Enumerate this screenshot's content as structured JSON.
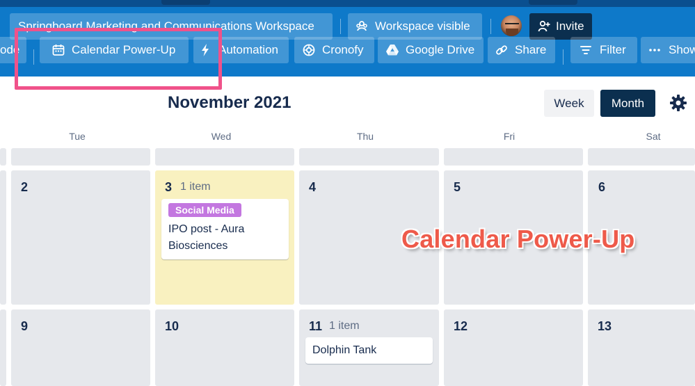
{
  "board": {
    "workspace_name": "Springboard Marketing and Communications Workspace",
    "visibility_label": "Workspace visible",
    "invite_label": "Invite"
  },
  "toolbar": {
    "cut_label": "ode",
    "calendar_label": "Calendar Power-Up",
    "automation_label": "Automation",
    "cronofy_label": "Cronofy",
    "google_drive_label": "Google Drive",
    "share_label": "Share",
    "filter_label": "Filter",
    "show_menu_label": "Show"
  },
  "calendar": {
    "month_title": "November 2021",
    "view_week_label": "Week",
    "view_month_label": "Month",
    "weekdays": [
      "Tue",
      "Wed",
      "Thu",
      "Fri",
      "Sat"
    ],
    "week1": {
      "days": [
        "2",
        "3",
        "4",
        "5",
        "6"
      ],
      "today_item_count": "1 item",
      "card": {
        "label": "Social Media",
        "title_line1": "IPO post - Aura",
        "title_line2": "Biosciences"
      }
    },
    "week2": {
      "days": [
        "9",
        "10",
        "11",
        "12",
        "13"
      ],
      "item_count": "1 item",
      "card": {
        "title": "Dolphin Tank"
      }
    }
  },
  "annotation": {
    "text": "Calendar Power-Up"
  },
  "colors": {
    "header_blue": "#0e79c9",
    "highlight_pink": "#f0528a",
    "label_purple": "#c377e0",
    "today_yellow": "#f9f1c0",
    "annotation_red": "#ee5a4a"
  }
}
